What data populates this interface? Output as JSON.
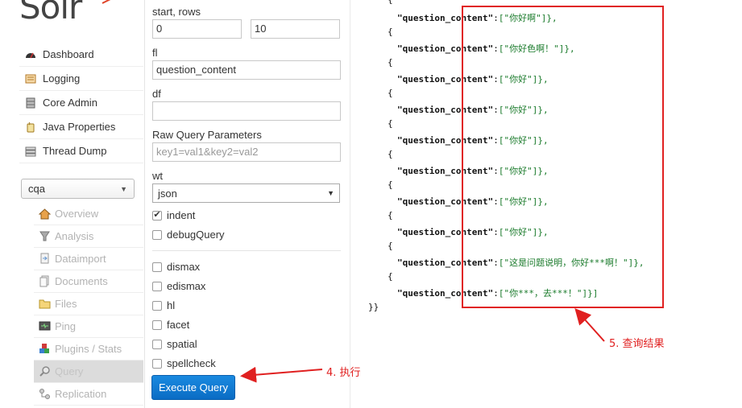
{
  "logo": {
    "text": "Solr"
  },
  "nav": {
    "items": [
      {
        "label": "Dashboard",
        "icon": "dashboard-icon"
      },
      {
        "label": "Logging",
        "icon": "logging-icon"
      },
      {
        "label": "Core Admin",
        "icon": "core-admin-icon"
      },
      {
        "label": "Java Properties",
        "icon": "java-properties-icon"
      },
      {
        "label": "Thread Dump",
        "icon": "thread-dump-icon"
      }
    ]
  },
  "core_selector": {
    "value": "cqa"
  },
  "core_menu": {
    "items": [
      {
        "label": "Overview",
        "icon": "overview-icon"
      },
      {
        "label": "Analysis",
        "icon": "analysis-icon"
      },
      {
        "label": "Dataimport",
        "icon": "dataimport-icon"
      },
      {
        "label": "Documents",
        "icon": "documents-icon"
      },
      {
        "label": "Files",
        "icon": "files-icon"
      },
      {
        "label": "Ping",
        "icon": "ping-icon"
      },
      {
        "label": "Plugins / Stats",
        "icon": "plugins-icon"
      },
      {
        "label": "Query",
        "icon": "query-icon",
        "active": true
      },
      {
        "label": "Replication",
        "icon": "replication-icon"
      }
    ]
  },
  "form": {
    "start_rows_label": "start, rows",
    "start_value": "0",
    "rows_value": "10",
    "fl_label": "fl",
    "fl_value": "question_content",
    "df_label": "df",
    "df_value": "",
    "raw_label": "Raw Query Parameters",
    "raw_placeholder": "key1=val1&key2=val2",
    "wt_label": "wt",
    "wt_value": "json",
    "indent_label": "indent",
    "indent_checked": true,
    "debug_label": "debugQuery",
    "options": [
      "dismax",
      "edismax",
      "hl",
      "facet",
      "spatial",
      "spellcheck"
    ],
    "execute_label": "Execute Query"
  },
  "results": {
    "key": "\"question_content\"",
    "values": [
      "[\"你好啊\"]},",
      "[\"你好色啊！\"]},",
      "[\"你好\"]},",
      "[\"你好\"]},",
      "[\"你好\"]},",
      "[\"你好\"]},",
      "[\"你好\"]},",
      "[\"你好\"]},",
      "[\"这是问题说明，你好***啊！\"]},",
      "[\"你***，去***！\"]}]"
    ],
    "open_brace": "{",
    "close_text": "}}"
  },
  "annotations": {
    "execute": "4. 执行",
    "result": "5. 查询结果",
    "accent_color": "#e02020"
  }
}
